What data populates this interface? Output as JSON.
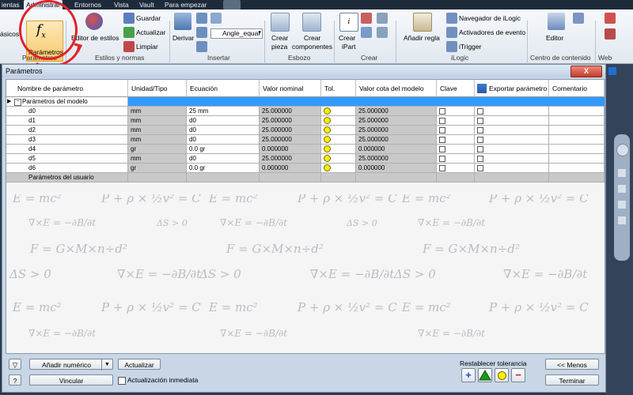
{
  "ribbon": {
    "tabs": [
      "ientas",
      "Administrar",
      "Entornos",
      "Vista",
      "Vault",
      "Para empezar"
    ],
    "parametros_label": "Parámetros",
    "basicos_label": "ásicos",
    "editor_estilos_label": "Editor de estilos",
    "guardar_label": "Guardar",
    "actualizar_label": "Actualizar",
    "limpiar_label": "Limpiar",
    "derivar_label": "Derivar",
    "angle_label": "Angle_equal",
    "crear_pieza_l1": "Crear",
    "crear_pieza_l2": "pieza",
    "crear_comp_l1": "Crear",
    "crear_comp_l2": "componentes",
    "crear_ipart_l1": "Crear",
    "crear_ipart_l2": "iPart",
    "anadir_regla_label": "Añadir regla",
    "navegador_label": "Navegador de iLogic",
    "activadores_label": "Activadores de evento",
    "itrigger_label": "iTrigger",
    "editor_label": "Editor",
    "groups": {
      "parametros": "Parámetros",
      "estilos": "Estilos y normas",
      "insertar": "Insertar",
      "esbozo": "Esbozo",
      "crear": "Crear",
      "ilogic": "iLogic",
      "contenido": "Centro de contenido",
      "web": "Web"
    }
  },
  "dialog": {
    "title": "Parámetros",
    "close_label": "X",
    "columns": [
      "Nombre de parámetro",
      "Unidad/Tipo",
      "Ecuación",
      "Valor nominal",
      "Tol.",
      "Valor cota del modelo",
      "Clave",
      "Exportar parámetro",
      "Comentario"
    ],
    "model_group_label": "Parámetros del modelo",
    "user_group_label": "Parámetros del usuario",
    "rows": [
      {
        "name": "d0",
        "unit": "mm",
        "equation": "25 mm",
        "nominal": "25.000000",
        "model": "25.000000"
      },
      {
        "name": "d1",
        "unit": "mm",
        "equation": "d0",
        "nominal": "25.000000",
        "model": "25.000000"
      },
      {
        "name": "d2",
        "unit": "mm",
        "equation": "d0",
        "nominal": "25.000000",
        "model": "25.000000"
      },
      {
        "name": "d3",
        "unit": "mm",
        "equation": "d0",
        "nominal": "25.000000",
        "model": "25.000000"
      },
      {
        "name": "d4",
        "unit": "gr",
        "equation": "0.0 gr",
        "nominal": "0.000000",
        "model": "0.000000"
      },
      {
        "name": "d5",
        "unit": "mm",
        "equation": "d0",
        "nominal": "25.000000",
        "model": "25.000000"
      },
      {
        "name": "d6",
        "unit": "gr",
        "equation": "0.0 gr",
        "nominal": "0.000000",
        "model": "0.000000"
      }
    ],
    "footer": {
      "add_numeric_label": "Añadir numérico",
      "actualizar_label": "Actualizar",
      "vincular_label": "Vincular",
      "immediate_update_label": "Actualización inmediata",
      "restablecer_label": "Restablecer tolerancia",
      "less_label": "<< Menos",
      "terminar_label": "Terminar"
    }
  },
  "colors": {
    "accent_blue": "#3399ff",
    "tol_yellow": "#ffee00",
    "red_annotation": "#e0222a"
  }
}
